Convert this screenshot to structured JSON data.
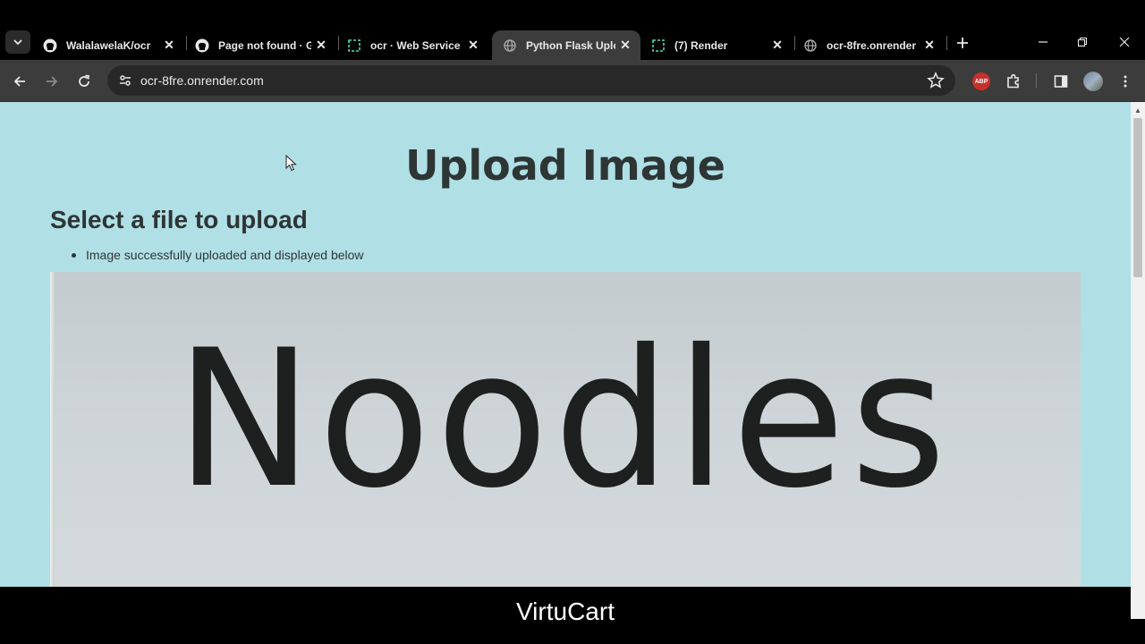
{
  "browser": {
    "tabs": [
      {
        "title": "WalalawelaK/ocr",
        "favicon": "github-icon",
        "active": false
      },
      {
        "title": "Page not found · G",
        "favicon": "github-icon",
        "active": false
      },
      {
        "title": "ocr · Web Service",
        "favicon": "render-icon",
        "active": false
      },
      {
        "title": "Python Flask Uplo",
        "favicon": "globe-icon",
        "active": true
      },
      {
        "title": "(7) Render",
        "favicon": "render-icon",
        "active": false
      },
      {
        "title": "ocr-8fre.onrender",
        "favicon": "globe-icon",
        "active": false
      }
    ],
    "address_bar": {
      "url": "ocr-8fre.onrender.com"
    },
    "extensions": {
      "abp_label": "ABP"
    }
  },
  "page": {
    "heading": "Upload Image",
    "subheading": "Select a file to upload",
    "flash_messages": [
      "Image successfully uploaded and displayed below"
    ],
    "image_text": "Noodles"
  },
  "overlay": {
    "bottom_label": "VirtuCart"
  },
  "colors": {
    "page_background": "#b0e0e6",
    "text": "#2e3535",
    "browser_frame": "#000000",
    "toolbar": "#3c3c3c",
    "abp_red": "#c8302c"
  }
}
